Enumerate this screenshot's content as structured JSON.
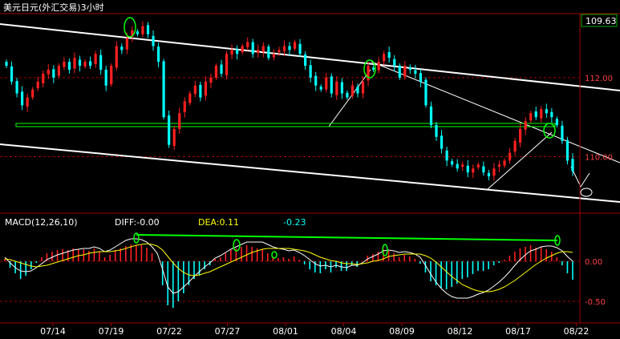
{
  "title": "美元日元(外汇交易)3小时",
  "price_badge": "109.63",
  "macd": {
    "label": "MACD(12,26,10)",
    "diff": "DIFF:-0.00",
    "dea": "DEA:0.11",
    "macd_value": "-0.23"
  },
  "colors": {
    "background": "#000000",
    "up": "#ff2020",
    "down": "#00ffff",
    "trendline": "#ffffff",
    "support": "#00ff00",
    "dif": "#ffffff",
    "dea": "#ffff00",
    "grid": "#a00000",
    "axis": "#a00000",
    "title": "#ffffff",
    "label_text": "#ff4040"
  },
  "chart_data": [
    {
      "type": "candlestick",
      "title": "美元日元(外汇交易)3小时",
      "x_ticks": [
        "07/14",
        "07/19",
        "07/22",
        "07/27",
        "08/01",
        "08/04",
        "08/09",
        "08/12",
        "08/17",
        "08/22"
      ],
      "y_ticks": [
        "112.00",
        "110.00"
      ],
      "last_price": 109.63,
      "ylim": [
        108.65,
        113.6
      ],
      "grid": "dashed-horizontal",
      "price_path_close": [
        112.3,
        111.9,
        111.6,
        111.3,
        111.5,
        111.7,
        111.9,
        112.1,
        112.2,
        112.0,
        112.3,
        112.4,
        112.2,
        112.5,
        112.3,
        112.4,
        112.3,
        112.6,
        112.2,
        111.8,
        112.3,
        112.8,
        112.7,
        113.0,
        113.2,
        113.1,
        113.3,
        113.1,
        112.8,
        112.4,
        111.0,
        110.3,
        110.7,
        111.1,
        111.4,
        111.6,
        111.8,
        111.5,
        111.9,
        112.0,
        112.3,
        112.1,
        112.6,
        112.7,
        112.6,
        112.8,
        112.9,
        112.6,
        112.7,
        112.8,
        112.5,
        112.6,
        112.7,
        112.8,
        112.7,
        112.9,
        112.6,
        112.3,
        112.0,
        111.8,
        111.7,
        112.0,
        111.6,
        111.9,
        111.6,
        111.5,
        111.8,
        111.6,
        111.9,
        112.3,
        112.2,
        112.4,
        112.6,
        112.5,
        112.3,
        112.0,
        112.3,
        112.2,
        112.1,
        111.9,
        111.3,
        110.8,
        110.5,
        110.2,
        109.9,
        109.8,
        109.7,
        109.8,
        109.6,
        109.7,
        109.8,
        109.6,
        109.5,
        109.7,
        109.8,
        109.9,
        110.1,
        110.4,
        110.7,
        110.9,
        111.1,
        111.0,
        111.2,
        111.1,
        111.0,
        110.8,
        110.4,
        109.9,
        109.63
      ],
      "annotations": [
        {
          "type": "trendline",
          "description": "descending upper channel line"
        },
        {
          "type": "trendline",
          "description": "descending lower channel line"
        },
        {
          "type": "horizontal-line",
          "value": 111.25,
          "color": "green",
          "description": "support line"
        },
        {
          "type": "ellipse",
          "description": "circled peaks"
        }
      ]
    },
    {
      "type": "macd",
      "title": "MACD(12,26,10)",
      "series": [
        {
          "name": "DIFF",
          "last": -0.0
        },
        {
          "name": "DEA",
          "last": 0.11
        },
        {
          "name": "MACD",
          "last": -0.23
        }
      ],
      "y_ticks": [
        "0.00",
        "-0.50"
      ],
      "ylim": [
        -0.72,
        0.38
      ],
      "histogram": [
        0.03,
        -0.08,
        -0.15,
        -0.22,
        -0.18,
        -0.1,
        -0.02,
        0.05,
        0.1,
        0.12,
        0.14,
        0.15,
        0.14,
        0.16,
        0.15,
        0.15,
        0.13,
        0.16,
        0.12,
        0.05,
        0.08,
        0.14,
        0.16,
        0.19,
        0.21,
        0.2,
        0.2,
        0.17,
        0.1,
        0.0,
        -0.3,
        -0.55,
        -0.58,
        -0.5,
        -0.4,
        -0.3,
        -0.22,
        -0.18,
        -0.1,
        -0.05,
        0.03,
        0.05,
        0.1,
        0.14,
        0.16,
        0.18,
        0.2,
        0.18,
        0.16,
        0.15,
        0.1,
        0.06,
        0.04,
        0.05,
        0.03,
        0.06,
        0.02,
        -0.04,
        -0.1,
        -0.14,
        -0.15,
        -0.1,
        -0.14,
        -0.08,
        -0.12,
        -0.12,
        -0.05,
        -0.07,
        0.0,
        0.07,
        0.09,
        0.12,
        0.15,
        0.13,
        0.1,
        0.05,
        0.08,
        0.06,
        0.03,
        -0.03,
        -0.14,
        -0.25,
        -0.3,
        -0.33,
        -0.35,
        -0.32,
        -0.28,
        -0.22,
        -0.2,
        -0.16,
        -0.12,
        -0.12,
        -0.1,
        -0.05,
        -0.02,
        0.02,
        0.07,
        0.12,
        0.16,
        0.18,
        0.2,
        0.17,
        0.18,
        0.15,
        0.12,
        0.05,
        -0.05,
        -0.15,
        -0.23
      ],
      "dif": [
        0.05,
        -0.02,
        -0.08,
        -0.12,
        -0.13,
        -0.12,
        -0.08,
        -0.03,
        0.02,
        0.05,
        0.08,
        0.1,
        0.12,
        0.14,
        0.15,
        0.16,
        0.16,
        0.18,
        0.16,
        0.12,
        0.14,
        0.18,
        0.22,
        0.26,
        0.28,
        0.28,
        0.27,
        0.24,
        0.18,
        0.1,
        -0.1,
        -0.32,
        -0.4,
        -0.38,
        -0.32,
        -0.26,
        -0.19,
        -0.13,
        -0.07,
        -0.02,
        0.04,
        0.07,
        0.11,
        0.15,
        0.18,
        0.21,
        0.24,
        0.24,
        0.24,
        0.24,
        0.21,
        0.18,
        0.16,
        0.15,
        0.13,
        0.14,
        0.11,
        0.07,
        0.02,
        -0.03,
        -0.06,
        -0.05,
        -0.07,
        -0.05,
        -0.07,
        -0.08,
        -0.05,
        -0.05,
        -0.02,
        0.03,
        0.06,
        0.09,
        0.13,
        0.14,
        0.13,
        0.11,
        0.12,
        0.11,
        0.09,
        0.05,
        -0.05,
        -0.16,
        -0.26,
        -0.34,
        -0.4,
        -0.44,
        -0.46,
        -0.46,
        -0.46,
        -0.44,
        -0.41,
        -0.39,
        -0.36,
        -0.31,
        -0.26,
        -0.2,
        -0.13,
        -0.05,
        0.02,
        0.08,
        0.13,
        0.15,
        0.18,
        0.19,
        0.19,
        0.17,
        0.13,
        0.06,
        -0.0
      ],
      "dea": [
        0.03,
        0.02,
        0.0,
        -0.02,
        -0.04,
        -0.06,
        -0.07,
        -0.06,
        -0.05,
        -0.03,
        -0.01,
        0.01,
        0.03,
        0.05,
        0.07,
        0.08,
        0.1,
        0.11,
        0.12,
        0.12,
        0.12,
        0.13,
        0.14,
        0.16,
        0.18,
        0.2,
        0.21,
        0.22,
        0.21,
        0.19,
        0.14,
        0.06,
        -0.02,
        -0.09,
        -0.14,
        -0.17,
        -0.18,
        -0.17,
        -0.15,
        -0.13,
        -0.1,
        -0.07,
        -0.04,
        -0.01,
        0.02,
        0.05,
        0.08,
        0.11,
        0.13,
        0.15,
        0.16,
        0.16,
        0.16,
        0.16,
        0.16,
        0.15,
        0.14,
        0.13,
        0.11,
        0.08,
        0.05,
        0.03,
        0.01,
        0.0,
        -0.02,
        -0.03,
        -0.03,
        -0.04,
        -0.03,
        -0.02,
        0.0,
        0.01,
        0.03,
        0.06,
        0.07,
        0.08,
        0.09,
        0.09,
        0.09,
        0.09,
        0.07,
        0.04,
        -0.01,
        -0.07,
        -0.13,
        -0.19,
        -0.24,
        -0.29,
        -0.32,
        -0.35,
        -0.37,
        -0.38,
        -0.38,
        -0.37,
        -0.35,
        -0.32,
        -0.28,
        -0.24,
        -0.19,
        -0.14,
        -0.09,
        -0.04,
        0.0,
        0.04,
        0.07,
        0.1,
        0.12,
        0.12,
        0.11
      ],
      "annotations": [
        {
          "type": "line",
          "color": "green",
          "description": "green line across MACD peaks"
        },
        {
          "type": "ellipse",
          "color": "green",
          "description": "circled MACD peaks"
        }
      ]
    }
  ]
}
